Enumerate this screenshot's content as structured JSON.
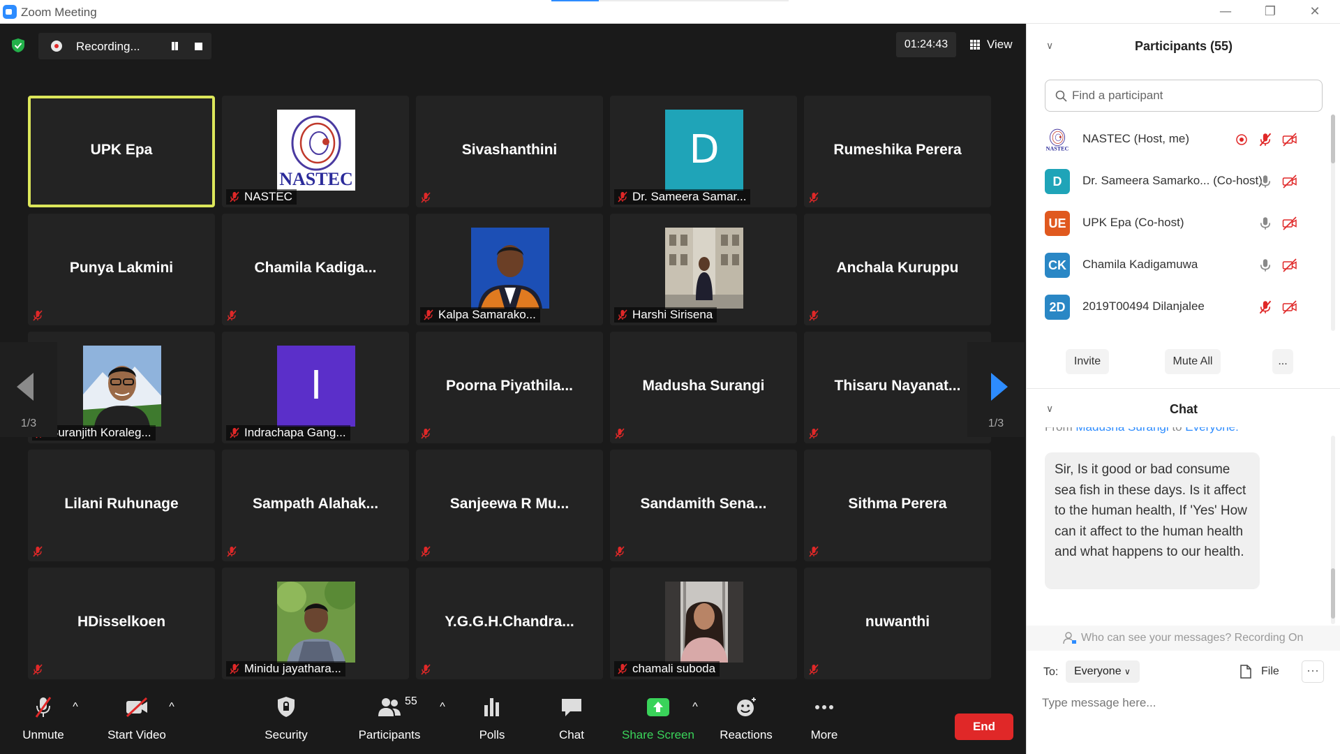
{
  "window": {
    "title": "Zoom Meeting",
    "minimize": "—",
    "restore": "❐",
    "close": "✕",
    "loading_progress": 0.2
  },
  "topbar": {
    "recording_label": "Recording...",
    "timer": "01:24:43",
    "view_label": "View"
  },
  "tiles": [
    {
      "name": "UPK Epa",
      "active": true,
      "tag": ""
    },
    {
      "name": "",
      "photo": "nastec-logo",
      "tag": "NASTEC"
    },
    {
      "name": "Sivashanthini",
      "tag": ""
    },
    {
      "name": "",
      "letter": "D",
      "letter_color": "#1fa4b8",
      "tag": "Dr. Sameera Samar..."
    },
    {
      "name": "Rumeshika Perera",
      "tag": ""
    },
    {
      "name": "Punya Lakmini",
      "tag": ""
    },
    {
      "name": "Chamila  Kadiga...",
      "tag": ""
    },
    {
      "name": "",
      "photo": "person-suit",
      "tag": "Kalpa Samarako..."
    },
    {
      "name": "",
      "photo": "person-street",
      "tag": "Harshi Sirisena"
    },
    {
      "name": "Anchala Kuruppu",
      "tag": ""
    },
    {
      "name": "",
      "photo": "person-mountain",
      "tag": "Suranjith Koraleg..."
    },
    {
      "name": "",
      "letter": "I",
      "letter_color": "#5b2fc9",
      "tag": "Indrachapa Gang..."
    },
    {
      "name": "Poorna  Piyathila...",
      "tag": ""
    },
    {
      "name": "Madusha Surangi",
      "tag": ""
    },
    {
      "name": "Thisaru  Nayanat...",
      "tag": ""
    },
    {
      "name": "Lilani Ruhunage",
      "tag": ""
    },
    {
      "name": "Sampath  Alahak...",
      "tag": ""
    },
    {
      "name": "Sanjeewa  R  Mu...",
      "tag": ""
    },
    {
      "name": "Sandamith  Sena...",
      "tag": ""
    },
    {
      "name": "Sithma Perera",
      "tag": ""
    },
    {
      "name": "HDisselkoen",
      "tag": ""
    },
    {
      "name": "",
      "photo": "person-green",
      "tag": "Minidu jayathara..."
    },
    {
      "name": "Y.G.G.H.Chandra...",
      "tag": ""
    },
    {
      "name": "",
      "photo": "person-woman",
      "tag": "chamali suboda"
    },
    {
      "name": "nuwanthi",
      "tag": ""
    }
  ],
  "pager": {
    "left_label": "1/3",
    "right_label": "1/3"
  },
  "toolbar": {
    "unmute": "Unmute",
    "start_video": "Start Video",
    "security": "Security",
    "participants": "Participants",
    "participants_count": "55",
    "polls": "Polls",
    "chat": "Chat",
    "share_screen": "Share Screen",
    "reactions": "Reactions",
    "more": "More",
    "end": "End",
    "caret": "^"
  },
  "panel": {
    "title": "Participants (55)",
    "search_placeholder": "Find a participant",
    "participants": [
      {
        "name": "NASTEC (Host, me)",
        "initials": "",
        "color": "#ffffff",
        "mic": "muted",
        "recording": true
      },
      {
        "name": "Dr. Sameera Samarko... (Co-host)",
        "initials": "D",
        "color": "#1fa4b8",
        "mic": "on"
      },
      {
        "name": "UPK Epa (Co-host)",
        "initials": "UE",
        "color": "#e0591f",
        "mic": "on"
      },
      {
        "name": "Chamila Kadigamuwa",
        "initials": "CK",
        "color": "#2a87c5",
        "mic": "on"
      },
      {
        "name": "2019T00494 Dilanjalee",
        "initials": "2D",
        "color": "#2a87c5",
        "mic": "muted"
      }
    ],
    "invite": "Invite",
    "mute_all": "Mute All",
    "more": "..."
  },
  "chat": {
    "title": "Chat",
    "from_prefix": "From ",
    "from_name": "Madusha Surangi",
    "from_mid": " to ",
    "from_target": "Everyone:",
    "message": "Sir, Is it good or bad consume sea fish in these days. Is it affect to the human health, If 'Yes' How can it affect to the human health and what happens to our health.",
    "visibility": "Who can see your messages? Recording On",
    "to_label": "To:",
    "to_value": "Everyone",
    "file_label": "File",
    "more_label": "···",
    "input_placeholder": "Type message here..."
  },
  "colors": {
    "accent": "#2d8cff",
    "active_border": "#dce65a",
    "end_red": "#e02828",
    "share_green": "#3ad35a",
    "muted_red": "#e02828"
  }
}
